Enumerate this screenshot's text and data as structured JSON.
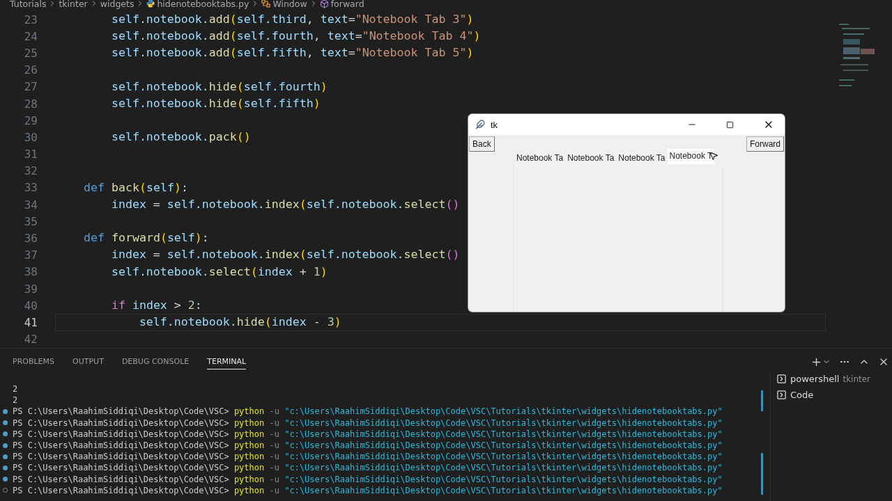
{
  "breadcrumb": [
    {
      "label": "Tutorials",
      "kind": "folder"
    },
    {
      "label": "tkinter",
      "kind": "folder"
    },
    {
      "label": "widgets",
      "kind": "folder"
    },
    {
      "label": "hidenotebooktabs.py",
      "kind": "file"
    },
    {
      "label": "Window",
      "kind": "class"
    },
    {
      "label": "forward",
      "kind": "method"
    }
  ],
  "editor": {
    "lines": [
      {
        "number": "23",
        "current": false,
        "tokens": [
          {
            "kind": "var",
            "text": "        self.notebook."
          },
          {
            "kind": "fn",
            "text": "add"
          },
          {
            "kind": "p1",
            "text": "("
          },
          {
            "kind": "var",
            "text": "self.third"
          },
          {
            "kind": "op",
            "text": ", "
          },
          {
            "kind": "var",
            "text": "text"
          },
          {
            "kind": "op",
            "text": "="
          },
          {
            "kind": "str",
            "text": "\"Notebook Tab 3\""
          },
          {
            "kind": "p1",
            "text": ")"
          }
        ]
      },
      {
        "number": "24",
        "current": false,
        "tokens": [
          {
            "kind": "var",
            "text": "        self.notebook."
          },
          {
            "kind": "fn",
            "text": "add"
          },
          {
            "kind": "p1",
            "text": "("
          },
          {
            "kind": "var",
            "text": "self.fourth"
          },
          {
            "kind": "op",
            "text": ", "
          },
          {
            "kind": "var",
            "text": "text"
          },
          {
            "kind": "op",
            "text": "="
          },
          {
            "kind": "str",
            "text": "\"Notebook Tab 4\""
          },
          {
            "kind": "p1",
            "text": ")"
          }
        ]
      },
      {
        "number": "25",
        "current": false,
        "tokens": [
          {
            "kind": "var",
            "text": "        self.notebook."
          },
          {
            "kind": "fn",
            "text": "add"
          },
          {
            "kind": "p1",
            "text": "("
          },
          {
            "kind": "var",
            "text": "self.fifth"
          },
          {
            "kind": "op",
            "text": ", "
          },
          {
            "kind": "var",
            "text": "text"
          },
          {
            "kind": "op",
            "text": "="
          },
          {
            "kind": "str",
            "text": "\"Notebook Tab 5\""
          },
          {
            "kind": "p1",
            "text": ")"
          }
        ]
      },
      {
        "number": "26",
        "current": false
      },
      {
        "number": "27",
        "current": false,
        "tokens": [
          {
            "kind": "var",
            "text": "        self.notebook."
          },
          {
            "kind": "fn",
            "text": "hide"
          },
          {
            "kind": "p1",
            "text": "("
          },
          {
            "kind": "var",
            "text": "self.fourth"
          },
          {
            "kind": "p1",
            "text": ")"
          }
        ]
      },
      {
        "number": "28",
        "current": false,
        "tokens": [
          {
            "kind": "var",
            "text": "        self.notebook."
          },
          {
            "kind": "fn",
            "text": "hide"
          },
          {
            "kind": "p1",
            "text": "("
          },
          {
            "kind": "var",
            "text": "self.fifth"
          },
          {
            "kind": "p1",
            "text": ")"
          }
        ]
      },
      {
        "number": "29",
        "current": false
      },
      {
        "number": "30",
        "current": false,
        "tokens": [
          {
            "kind": "var",
            "text": "        self.notebook."
          },
          {
            "kind": "fn",
            "text": "pack"
          },
          {
            "kind": "p1",
            "text": "()"
          }
        ]
      },
      {
        "number": "31",
        "current": false
      },
      {
        "number": "32",
        "current": false
      },
      {
        "number": "33",
        "current": false,
        "tokens": [
          {
            "kind": "kw",
            "text": "    def "
          },
          {
            "kind": "fn",
            "text": "back"
          },
          {
            "kind": "p1",
            "text": "("
          },
          {
            "kind": "var",
            "text": "self"
          },
          {
            "kind": "p1",
            "text": ")"
          },
          {
            "kind": "op",
            "text": ":"
          }
        ]
      },
      {
        "number": "34",
        "current": false,
        "tokens": [
          {
            "kind": "var",
            "text": "        index"
          },
          {
            "kind": "op",
            "text": " = "
          },
          {
            "kind": "var",
            "text": "self.notebook."
          },
          {
            "kind": "fn",
            "text": "index"
          },
          {
            "kind": "p1",
            "text": "("
          },
          {
            "kind": "var",
            "text": "self.notebook."
          },
          {
            "kind": "fn",
            "text": "select"
          },
          {
            "kind": "p2",
            "text": "()"
          }
        ]
      },
      {
        "number": "35",
        "current": false
      },
      {
        "number": "36",
        "current": false,
        "tokens": [
          {
            "kind": "kw",
            "text": "    def "
          },
          {
            "kind": "fn",
            "text": "forward"
          },
          {
            "kind": "p1",
            "text": "("
          },
          {
            "kind": "var",
            "text": "self"
          },
          {
            "kind": "p1",
            "text": ")"
          },
          {
            "kind": "op",
            "text": ":"
          }
        ]
      },
      {
        "number": "37",
        "current": false,
        "tokens": [
          {
            "kind": "var",
            "text": "        index"
          },
          {
            "kind": "op",
            "text": " = "
          },
          {
            "kind": "var",
            "text": "self.notebook."
          },
          {
            "kind": "fn",
            "text": "index"
          },
          {
            "kind": "p1",
            "text": "("
          },
          {
            "kind": "var",
            "text": "self.notebook."
          },
          {
            "kind": "fn",
            "text": "select"
          },
          {
            "kind": "p2",
            "text": "()"
          }
        ]
      },
      {
        "number": "38",
        "current": false,
        "tokens": [
          {
            "kind": "var",
            "text": "        self.notebook."
          },
          {
            "kind": "fn",
            "text": "select"
          },
          {
            "kind": "p1",
            "text": "("
          },
          {
            "kind": "var",
            "text": "index"
          },
          {
            "kind": "op",
            "text": " + "
          },
          {
            "kind": "num",
            "text": "1"
          },
          {
            "kind": "p1",
            "text": ")"
          }
        ]
      },
      {
        "number": "39",
        "current": false
      },
      {
        "number": "40",
        "current": false,
        "tokens": [
          {
            "kind": "ctrl",
            "text": "        if "
          },
          {
            "kind": "var",
            "text": "index"
          },
          {
            "kind": "op",
            "text": " > "
          },
          {
            "kind": "num",
            "text": "2"
          },
          {
            "kind": "op",
            "text": ":"
          }
        ]
      },
      {
        "number": "41",
        "current": true,
        "tokens": [
          {
            "kind": "var",
            "text": "            self.notebook."
          },
          {
            "kind": "fn",
            "text": "hide"
          },
          {
            "kind": "p1",
            "text": "("
          },
          {
            "kind": "var",
            "text": "index"
          },
          {
            "kind": "op",
            "text": " - "
          },
          {
            "kind": "num",
            "text": "3"
          },
          {
            "kind": "p1",
            "text": ")"
          }
        ]
      },
      {
        "number": "42",
        "current": false
      }
    ]
  },
  "tk_window": {
    "title": "tk",
    "back_button": "Back",
    "forward_button": "Forward",
    "tabs": [
      {
        "label": "Notebook Ta",
        "selected": false
      },
      {
        "label": "Notebook Ta",
        "selected": false
      },
      {
        "label": "Notebook Ta",
        "selected": false
      },
      {
        "label": "Notebook T",
        "selected": true
      }
    ]
  },
  "panel": {
    "tabs": [
      {
        "label": "PROBLEMS",
        "selected": false
      },
      {
        "label": "OUTPUT",
        "selected": false
      },
      {
        "label": "DEBUG CONSOLE",
        "selected": false
      },
      {
        "label": "TERMINAL",
        "selected": true
      }
    ],
    "terminal_lines": [
      {
        "kind": "output",
        "text": "2"
      },
      {
        "kind": "output",
        "text": "2"
      },
      {
        "kind": "command",
        "finished": true,
        "prompt": "PS C:\\Users\\RaahimSiddiqi\\Desktop\\Code\\VSC> ",
        "command": "python",
        "flag": " -u ",
        "path": "\"c:\\Users\\RaahimSiddiqi\\Desktop\\Code\\VSC\\Tutorials\\tkinter\\widgets\\hidenotebooktabs.py\""
      },
      {
        "kind": "command",
        "finished": true,
        "prompt": "PS C:\\Users\\RaahimSiddiqi\\Desktop\\Code\\VSC> ",
        "command": "python",
        "flag": " -u ",
        "path": "\"c:\\Users\\RaahimSiddiqi\\Desktop\\Code\\VSC\\Tutorials\\tkinter\\widgets\\hidenotebooktabs.py\""
      },
      {
        "kind": "command",
        "finished": true,
        "prompt": "PS C:\\Users\\RaahimSiddiqi\\Desktop\\Code\\VSC> ",
        "command": "python",
        "flag": " -u ",
        "path": "\"c:\\Users\\RaahimSiddiqi\\Desktop\\Code\\VSC\\Tutorials\\tkinter\\widgets\\hidenotebooktabs.py\""
      },
      {
        "kind": "command",
        "finished": true,
        "prompt": "PS C:\\Users\\RaahimSiddiqi\\Desktop\\Code\\VSC> ",
        "command": "python",
        "flag": " -u ",
        "path": "\"c:\\Users\\RaahimSiddiqi\\Desktop\\Code\\VSC\\Tutorials\\tkinter\\widgets\\hidenotebooktabs.py\""
      },
      {
        "kind": "command",
        "finished": true,
        "prompt": "PS C:\\Users\\RaahimSiddiqi\\Desktop\\Code\\VSC> ",
        "command": "python",
        "flag": " -u ",
        "path": "\"c:\\Users\\RaahimSiddiqi\\Desktop\\Code\\VSC\\Tutorials\\tkinter\\widgets\\hidenotebooktabs.py\""
      },
      {
        "kind": "command",
        "finished": true,
        "prompt": "PS C:\\Users\\RaahimSiddiqi\\Desktop\\Code\\VSC> ",
        "command": "python",
        "flag": " -u ",
        "path": "\"c:\\Users\\RaahimSiddiqi\\Desktop\\Code\\VSC\\Tutorials\\tkinter\\widgets\\hidenotebooktabs.py\""
      },
      {
        "kind": "command",
        "finished": true,
        "prompt": "PS C:\\Users\\RaahimSiddiqi\\Desktop\\Code\\VSC> ",
        "command": "python",
        "flag": " -u ",
        "path": "\"c:\\Users\\RaahimSiddiqi\\Desktop\\Code\\VSC\\Tutorials\\tkinter\\widgets\\hidenotebooktabs.py\""
      },
      {
        "kind": "command",
        "finished": false,
        "prompt": "PS C:\\Users\\RaahimSiddiqi\\Desktop\\Code\\VSC> ",
        "command": "python",
        "flag": " -u ",
        "path": "\"c:\\Users\\RaahimSiddiqi\\Desktop\\Code\\VSC\\Tutorials\\tkinter\\widgets\\hidenotebooktabs.py\""
      }
    ],
    "terminals": [
      {
        "name": "powershell",
        "detail": "tkinter"
      },
      {
        "name": "Code"
      }
    ]
  }
}
